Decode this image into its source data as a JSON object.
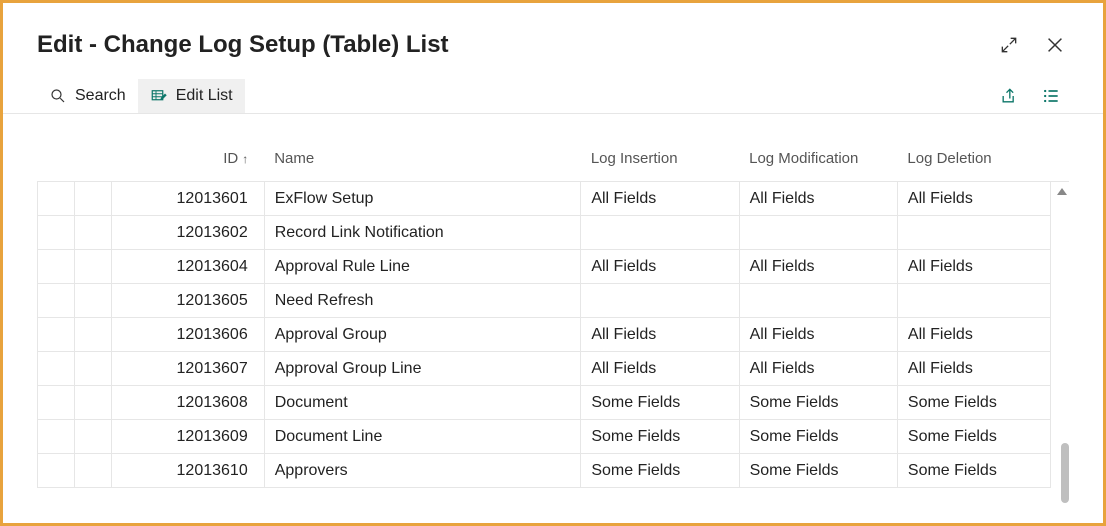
{
  "header": {
    "title": "Edit - Change Log Setup (Table) List"
  },
  "toolbar": {
    "search_label": "Search",
    "edit_list_label": "Edit List"
  },
  "columns": {
    "id": "ID",
    "name": "Name",
    "log_insertion": "Log Insertion",
    "log_modification": "Log Modification",
    "log_deletion": "Log Deletion"
  },
  "rows": [
    {
      "id": "12013601",
      "name": "ExFlow Setup",
      "ins": "All Fields",
      "mod": "All Fields",
      "del": "All Fields"
    },
    {
      "id": "12013602",
      "name": "Record Link Notification",
      "ins": "",
      "mod": "",
      "del": ""
    },
    {
      "id": "12013604",
      "name": "Approval Rule Line",
      "ins": "All Fields",
      "mod": "All Fields",
      "del": "All Fields"
    },
    {
      "id": "12013605",
      "name": "Need Refresh",
      "ins": "",
      "mod": "",
      "del": ""
    },
    {
      "id": "12013606",
      "name": "Approval Group",
      "ins": "All Fields",
      "mod": "All Fields",
      "del": "All Fields"
    },
    {
      "id": "12013607",
      "name": "Approval Group Line",
      "ins": "All Fields",
      "mod": "All Fields",
      "del": "All Fields"
    },
    {
      "id": "12013608",
      "name": "Document",
      "ins": "Some Fields",
      "mod": "Some Fields",
      "del": "Some Fields"
    },
    {
      "id": "12013609",
      "name": "Document Line",
      "ins": "Some Fields",
      "mod": "Some Fields",
      "del": "Some Fields"
    },
    {
      "id": "12013610",
      "name": "Approvers",
      "ins": "Some Fields",
      "mod": "Some Fields",
      "del": "Some Fields"
    }
  ]
}
